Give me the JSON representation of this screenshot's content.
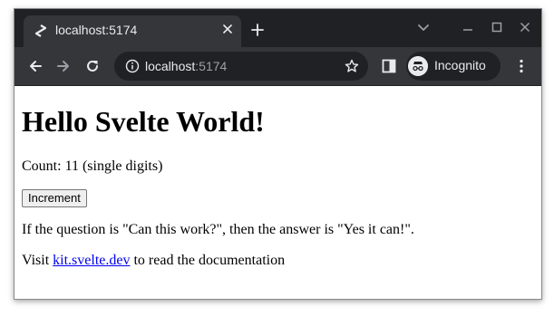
{
  "browser": {
    "tab": {
      "title": "localhost:5174"
    },
    "address_bar": {
      "host": "localhost",
      "port": ":5174"
    },
    "incognito_label": "Incognito",
    "colors": {
      "frame": "#202124",
      "toolbar": "#35363a",
      "text": "#e8eaed",
      "muted": "#9aa0a6"
    }
  },
  "page": {
    "heading": "Hello Svelte World!",
    "count_text": "Count: 11 (single digits)",
    "increment_label": "Increment",
    "question_text": "If the question is \"Can this work?\", then the answer is \"Yes it can!\".",
    "visit_prefix": "Visit ",
    "link_text": "kit.svelte.dev",
    "visit_suffix": " to read the documentation",
    "colors": {
      "link": "#0000ee"
    }
  },
  "icons": {
    "tab_favicon": "svelte-page-icon",
    "tab_close": "close-icon",
    "new_tab": "plus-icon",
    "tab_search": "chevron-down-icon",
    "back": "arrow-left-icon",
    "forward": "arrow-right-icon",
    "reload": "reload-icon",
    "site_info": "info-icon",
    "bookmark": "star-icon",
    "side_panel": "side-panel-icon",
    "incognito": "incognito-icon",
    "menu": "kebab-menu-icon"
  }
}
